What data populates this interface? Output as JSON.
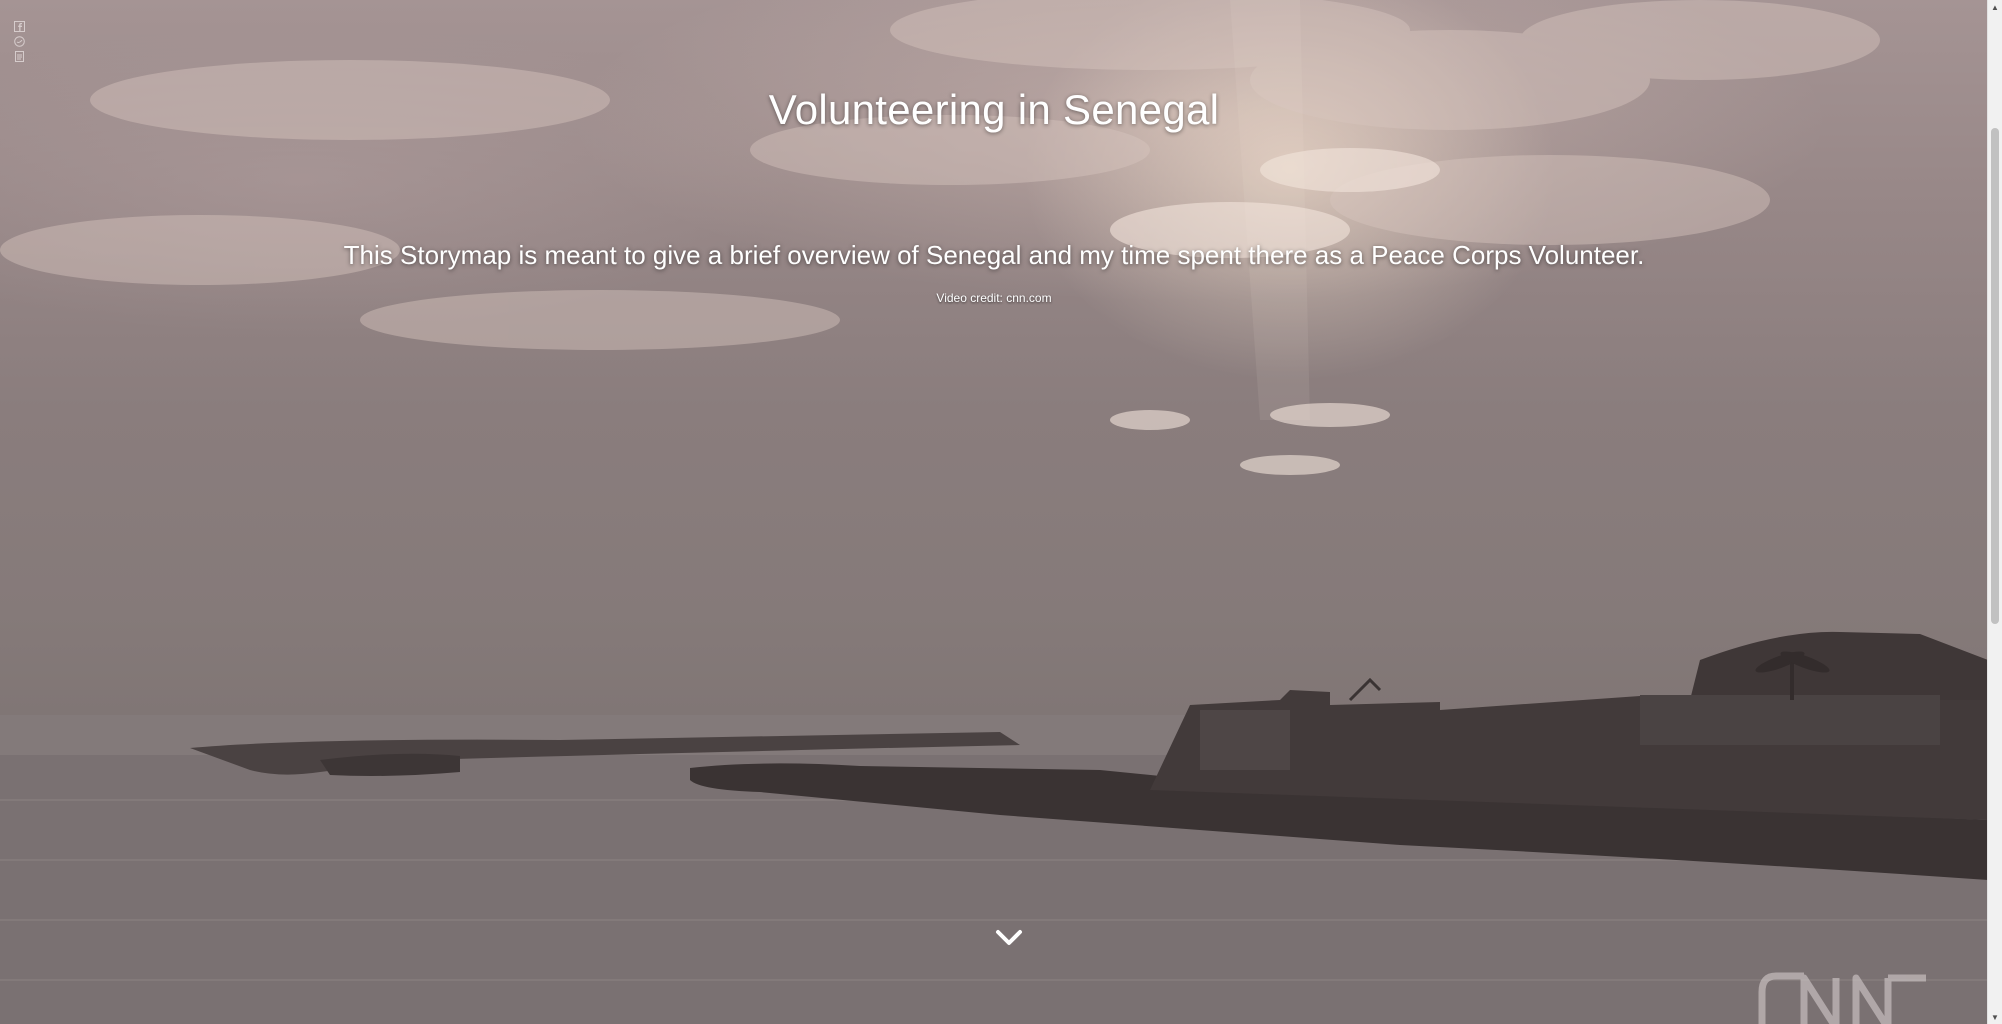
{
  "story": {
    "title": "Volunteering in Senegal",
    "subtitle": "This Storymap is meant to give a brief overview of Senegal and my time spent there as a Peace Corps Volunteer.",
    "credit": "Video credit: cnn.com"
  },
  "share": {
    "icons": [
      "facebook-icon",
      "twitter-icon",
      "link-icon"
    ]
  },
  "background": {
    "watermark": "CNN",
    "sky_color": "#978787",
    "sea_color": "#7c7373"
  },
  "navigation": {
    "scroll_down_icon": "chevron-down-icon"
  }
}
